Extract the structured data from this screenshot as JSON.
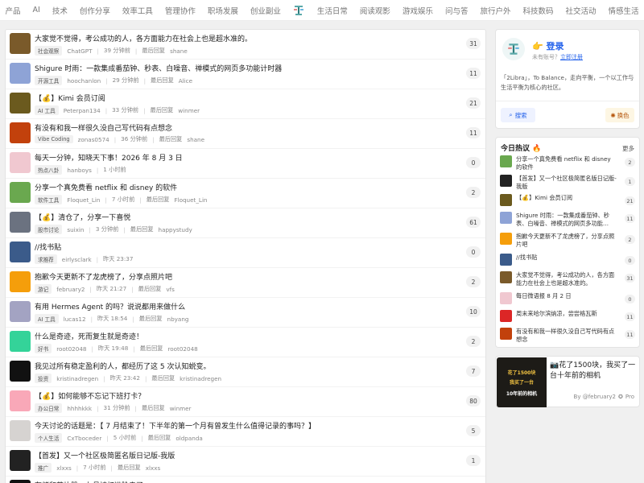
{
  "nav": {
    "left": [
      "产品",
      "AI",
      "技术",
      "创作分享",
      "效率工具",
      "管理协作",
      "职场发展",
      "创业副业"
    ],
    "right": [
      "生活日常",
      "阅读观影",
      "游戏娱乐",
      "问与答",
      "旅行户外",
      "科技数码",
      "社交活动",
      "情感生活"
    ]
  },
  "topics": [
    {
      "title": "大家觉不觉得，考公成功的人，各方面能力在社会上也是超水准的。",
      "tag": "社会观察",
      "author": "ChatGPT",
      "time": "39 分钟前",
      "last_label": "最后回复",
      "last": "shane",
      "count": "31",
      "color": "#7a5a2a"
    },
    {
      "title": "Shigure 时雨：一款集成番茄钟、秒表、白噪音、禅模式的网页多功能计时器",
      "tag": "开源工具",
      "author": "hoochanlon",
      "time": "29 分钟前",
      "last_label": "最后回复",
      "last": "Alice",
      "count": "11",
      "color": "#8ea3d6"
    },
    {
      "title": "【💰】Kimi 会员订阅",
      "tag": "AI 工具",
      "author": "Peterpan134",
      "time": "33 分钟前",
      "last_label": "最后回复",
      "last": "winmer",
      "count": "21",
      "color": "#6b5a1e"
    },
    {
      "title": "有没有和我一样很久没自己写代码有点想念",
      "tag": "Vibe Coding",
      "author": "zonas0574",
      "time": "36 分钟前",
      "last_label": "最后回复",
      "last": "shane",
      "count": "11",
      "color": "#c2410c"
    },
    {
      "title": "每天一分钟，知晓天下事！2026 年 8 月 3 日",
      "tag": "热点八卦",
      "author": "hanboys",
      "time": "1 小时前",
      "last_label": "",
      "last": "",
      "count": "0",
      "color": "#f0c8d0"
    },
    {
      "title": "分享一个真免费看 netflix 和 disney 的软件",
      "tag": "软件工具",
      "author": "Floquet_Lin",
      "time": "7 小时前",
      "last_label": "最后回复",
      "last": "Floquet_Lin",
      "count": "2",
      "color": "#6aa84f"
    },
    {
      "title": "【💰】清仓了，分享一下喜悦",
      "tag": "股市讨论",
      "author": "suixin",
      "time": "3 分钟前",
      "last_label": "最后回复",
      "last": "happystudy",
      "count": "61",
      "color": "#6b7280"
    },
    {
      "title": "//找书贴",
      "tag": "求推荐",
      "author": "eirlysclark",
      "time": "昨天 23:37",
      "last_label": "",
      "last": "",
      "count": "0",
      "color": "#3b5b8a"
    },
    {
      "title": "抱歉今天更新不了龙虎榜了，分享点照片吧",
      "tag": "游记",
      "author": "february2",
      "time": "昨天 21:27",
      "last_label": "最后回复",
      "last": "vfs",
      "count": "2",
      "color": "#f59e0b"
    },
    {
      "title": "有用 Hermes Agent 的吗？说说都用来做什么",
      "tag": "AI 工具",
      "author": "lucas12",
      "time": "昨天 18:54",
      "last_label": "最后回复",
      "last": "nbyang",
      "count": "10",
      "color": "#a3a3c2"
    },
    {
      "title": "什么是奇迹，死而复生就是奇迹！",
      "tag": "好书",
      "author": "root02048",
      "time": "昨天 19:48",
      "last_label": "最后回复",
      "last": "root02048",
      "count": "2",
      "color": "#34d399"
    },
    {
      "title": "我见过所有稳定盈利的人，都经历了这 5 次认知蜕变。",
      "tag": "投资",
      "author": "kristinadregen",
      "time": "昨天 23:42",
      "last_label": "最后回复",
      "last": "kristinadregen",
      "count": "7",
      "color": "#111111"
    },
    {
      "title": "【💰】如何能够不忘记下班打卡？",
      "tag": "办公日常",
      "author": "hhhhkkk",
      "time": "31 分钟前",
      "last_label": "最后回复",
      "last": "winmer",
      "count": "80",
      "color": "#f9a8b8"
    },
    {
      "title": "今天讨论的话题是：【 7 月结束了！下半年的第一个月有曾发生什么值得记录的事吗？】",
      "tag": "个人生活",
      "author": "CxTboceder",
      "time": "5 小时前",
      "last_label": "最后回复",
      "last": "oldpanda",
      "count": "5",
      "color": "#d6d3d1"
    },
    {
      "title": "【首发】又一个社区极简匿名版日记版-我版",
      "tag": "推广",
      "author": "xlxxs",
      "time": "7 小时前",
      "last_label": "最后回复",
      "last": "xlxxs",
      "count": "1",
      "color": "#222222"
    },
    {
      "title": "存储和芯片股，七月被打进脸走了",
      "tag": "",
      "author": "",
      "time": "",
      "last_label": "",
      "last": "",
      "count": "",
      "color": "#111111"
    }
  ],
  "login": {
    "title": "登录",
    "sub_prefix": "未有账号？",
    "register": "立即注册",
    "desc": "「2Libra」，To Balance，走向平衡，一个以工作与生活平衡为核心的社区。",
    "search": "搜索",
    "color": "换色"
  },
  "hot": {
    "title": "今日热议",
    "more": "更多",
    "items": [
      {
        "title": "分享一个真免费看 netflix 和 disney 的软件",
        "count": "2",
        "color": "#6aa84f"
      },
      {
        "title": "【首发】又一个社区极简匿名版日记版-我版",
        "count": "1",
        "color": "#222222"
      },
      {
        "title": "【💰】Kimi 会员订阅",
        "count": "21",
        "color": "#6b5a1e"
      },
      {
        "title": "Shigure 时雨：一款集成番茄钟、秒表、白噪音、禅模式的网页多功能…",
        "count": "11",
        "color": "#8ea3d6"
      },
      {
        "title": "抱歉今天更新不了龙虎榜了，分享点照片吧",
        "count": "2",
        "color": "#f59e0b"
      },
      {
        "title": "//找书贴",
        "count": "0",
        "color": "#3b5b8a"
      },
      {
        "title": "大家觉不觉得，考公成功的人，各方面能力在社会上也是超水准的。",
        "count": "31",
        "color": "#7a5a2a"
      },
      {
        "title": "每日微语报 8 月 2 日",
        "count": "0",
        "color": "#f0c8d0"
      },
      {
        "title": "周末来哈尔滨纳凉，尝尝格瓦斯",
        "count": "11",
        "color": "#dc2626"
      },
      {
        "title": "有没有和我一样很久没自己写代码有点想念",
        "count": "11",
        "color": "#c2410c"
      }
    ]
  },
  "promo": {
    "title": "📷花了1500块，我买了一台十年前的相机",
    "by": "By @february2",
    "pro": "Pro",
    "img_lines": [
      "花了1500块",
      "我买了一台",
      "10年前的相机"
    ]
  }
}
